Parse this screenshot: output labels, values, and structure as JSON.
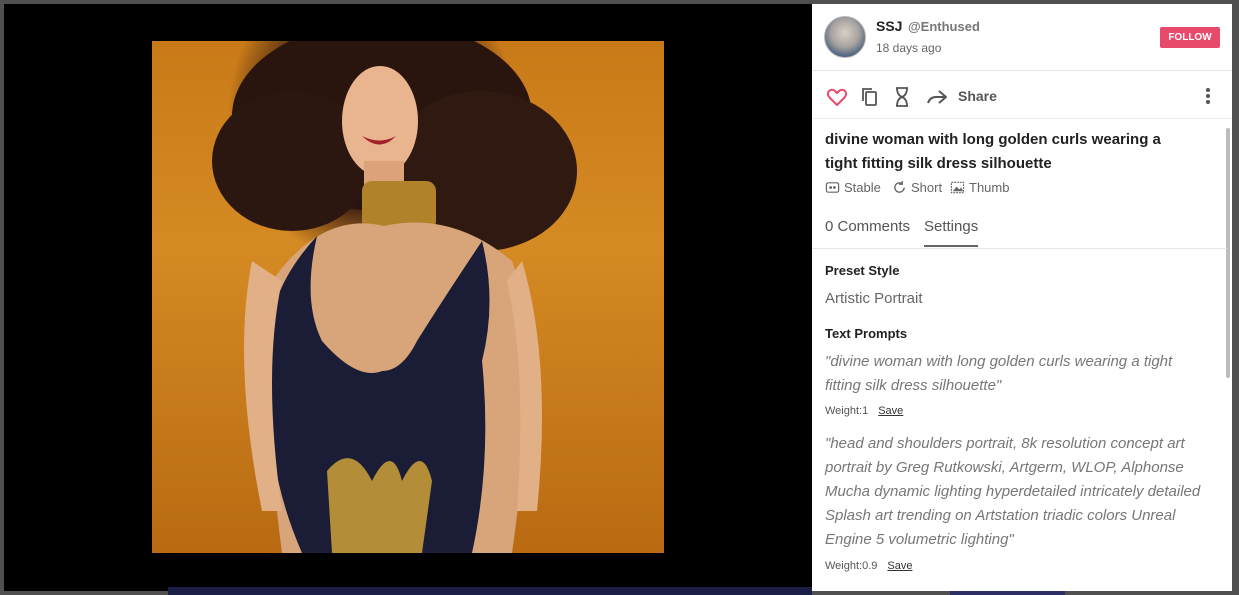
{
  "header": {
    "username": "SSJ",
    "handle": "@Enthused",
    "posted_ago": "18 days ago",
    "follow_label": "FOLLOW"
  },
  "actions": {
    "share_label": "Share",
    "icons": [
      "heart-icon",
      "copy-icon",
      "hourglass-icon",
      "share-arrow-icon",
      "more-vertical-icon"
    ]
  },
  "creation": {
    "title": "divine woman with long golden curls wearing a tight fitting silk dress silhouette",
    "tags": [
      {
        "icon": "stable-icon",
        "label": "Stable"
      },
      {
        "icon": "refresh-icon",
        "label": "Short"
      },
      {
        "icon": "thumb-image-icon",
        "label": "Thumb"
      }
    ]
  },
  "tabs": [
    {
      "label": "0 Comments",
      "active": false
    },
    {
      "label": "Settings",
      "active": true
    }
  ],
  "settings": {
    "preset_style_heading": "Preset Style",
    "preset_style_value": "Artistic Portrait",
    "text_prompts_heading": "Text Prompts",
    "prompts": [
      {
        "text": "\"divine woman with long golden curls wearing a tight fitting silk dress silhouette\"",
        "weight": "Weight:1",
        "save_label": "Save"
      },
      {
        "text": "\"head and shoulders portrait, 8k resolution concept art portrait by Greg Rutkowski, Artgerm, WLOP, Alphonse Mucha dynamic lighting hyperdetailed intricately detailed Splash art trending on Artstation triadic colors Unreal Engine 5 volumetric lighting\"",
        "weight": "Weight:0.9",
        "save_label": "Save"
      }
    ]
  },
  "colors": {
    "follow": "#e84a6b",
    "heart": "#e84a6b",
    "viewer_bg": "#000000",
    "artwork_gold": "#d58a23"
  }
}
